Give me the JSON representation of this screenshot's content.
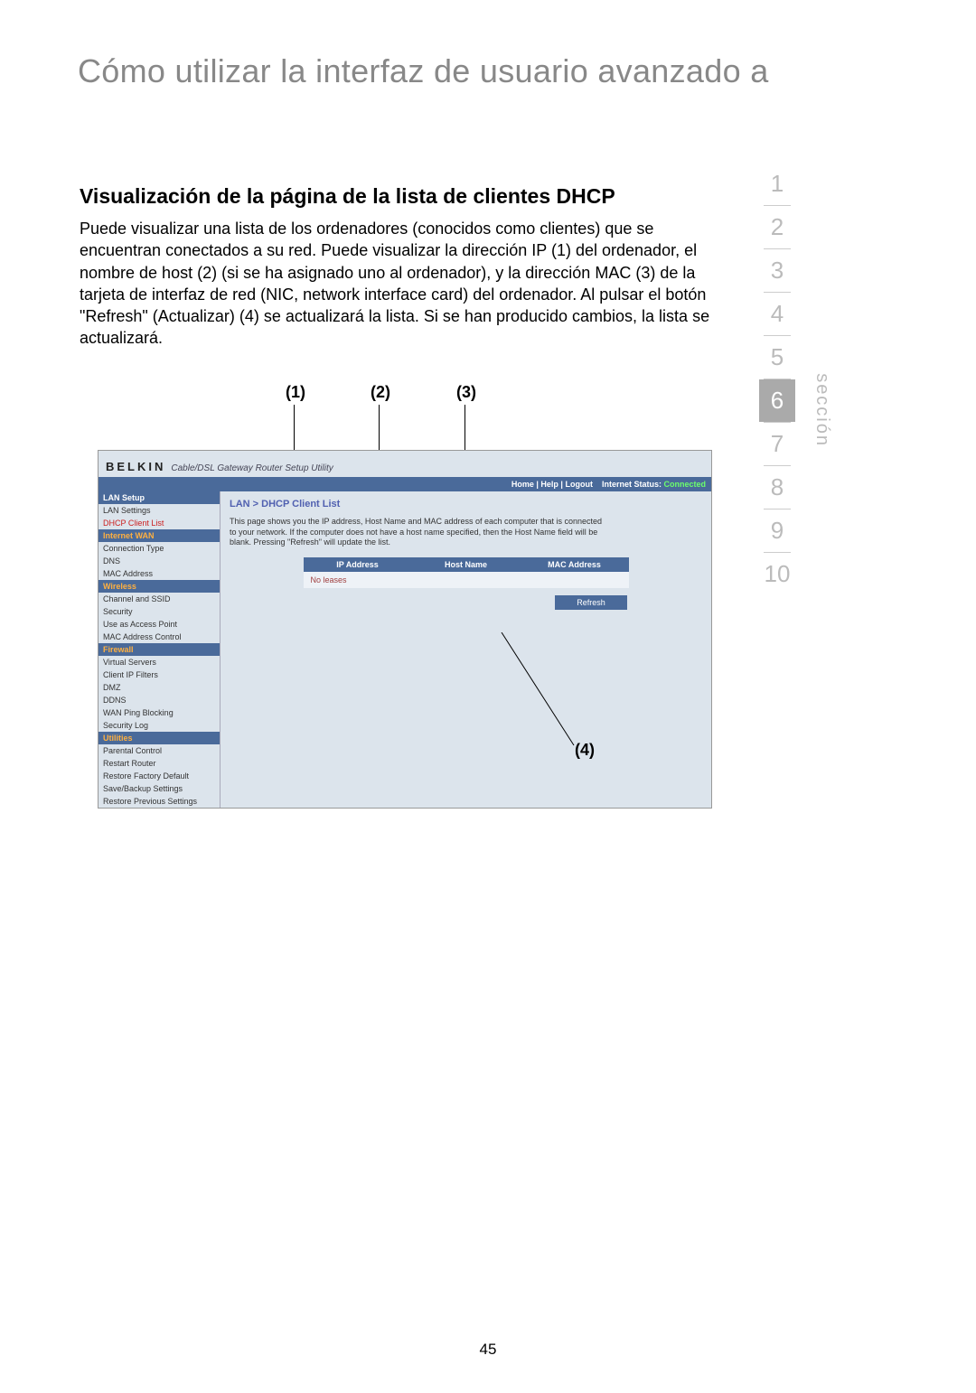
{
  "page_title": "Cómo utilizar la interfaz de usuario avanzado a",
  "section_label": "sección",
  "section_nav": [
    "1",
    "2",
    "3",
    "4",
    "5",
    "6",
    "7",
    "8",
    "9",
    "10"
  ],
  "active_section": "6",
  "heading": "Visualización de la página de la lista de clientes DHCP",
  "paragraph": "Puede visualizar una lista de los ordenadores (conocidos como clientes) que se encuentran conectados a su red. Puede visualizar la dirección IP (1) del ordenador, el nombre de host (2) (si se ha asignado uno al ordenador), y la dirección MAC (3) de la tarjeta de interfaz de red (NIC, network interface card) del ordenador. Al pulsar el botón \"Refresh\" (Actualizar) (4) se actualizará la lista. Si se han producido cambios, la lista se actualizará.",
  "callouts": {
    "c1": "(1)",
    "c2": "(2)",
    "c3": "(3)",
    "c4": "(4)"
  },
  "screenshot": {
    "brand": "BELKIN",
    "subtitle": "Cable/DSL Gateway Router Setup Utility",
    "topbar_links": "Home | Help | Logout",
    "topbar_status_label": "Internet Status:",
    "topbar_status_value": "Connected",
    "sidebar": [
      {
        "type": "cat",
        "label": "LAN Setup"
      },
      {
        "type": "item",
        "label": "LAN Settings"
      },
      {
        "type": "item-red",
        "label": "DHCP Client List"
      },
      {
        "type": "cat-orange",
        "label": "Internet WAN"
      },
      {
        "type": "item",
        "label": "Connection Type"
      },
      {
        "type": "item",
        "label": "DNS"
      },
      {
        "type": "item",
        "label": "MAC Address"
      },
      {
        "type": "cat-orange",
        "label": "Wireless"
      },
      {
        "type": "item",
        "label": "Channel and SSID"
      },
      {
        "type": "item",
        "label": "Security"
      },
      {
        "type": "item",
        "label": "Use as Access Point"
      },
      {
        "type": "item",
        "label": "MAC Address Control"
      },
      {
        "type": "cat-orange",
        "label": "Firewall"
      },
      {
        "type": "item",
        "label": "Virtual Servers"
      },
      {
        "type": "item",
        "label": "Client IP Filters"
      },
      {
        "type": "item",
        "label": "DMZ"
      },
      {
        "type": "item",
        "label": "DDNS"
      },
      {
        "type": "item",
        "label": "WAN Ping Blocking"
      },
      {
        "type": "item",
        "label": "Security Log"
      },
      {
        "type": "cat-orange",
        "label": "Utilities"
      },
      {
        "type": "item",
        "label": "Parental Control"
      },
      {
        "type": "item",
        "label": "Restart Router"
      },
      {
        "type": "item",
        "label": "Restore Factory Default"
      },
      {
        "type": "item",
        "label": "Save/Backup Settings"
      },
      {
        "type": "item",
        "label": "Restore Previous Settings"
      }
    ],
    "breadcrumb": "LAN > DHCP Client List",
    "description": "This page shows you the IP address, Host Name and MAC address of each computer that is connected to your network. If the computer does not have a host name specified, then the Host Name field will be blank. Pressing \"Refresh\" will update the list.",
    "table_headers": [
      "IP Address",
      "Host Name",
      "MAC Address"
    ],
    "no_leases": "No leases",
    "refresh_button": "Refresh"
  },
  "page_number": "45"
}
